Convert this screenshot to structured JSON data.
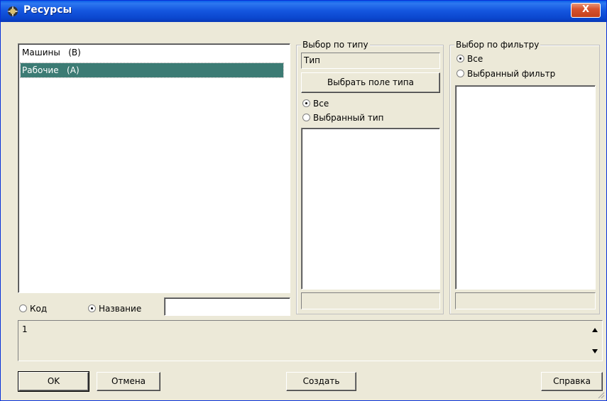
{
  "window": {
    "title": "Ресурсы",
    "close_label": "X"
  },
  "resources_list": {
    "items": [
      {
        "label": "Машины   (В)",
        "selected": false
      },
      {
        "label": "Рабочие   (А)",
        "selected": true
      }
    ]
  },
  "search": {
    "code_label": "Код",
    "name_label": "Название",
    "selected": "name",
    "value": ""
  },
  "type_filter": {
    "group_label": "Выбор по типу",
    "type_field_value": "Тип",
    "choose_button": "Выбрать поле типа",
    "radio_all": "Все",
    "radio_selected": "Выбранный тип",
    "selected": "all"
  },
  "filter_select": {
    "group_label": "Выбор по фильтру",
    "radio_all": "Все",
    "radio_selected": "Выбранный фильтр",
    "selected": "all"
  },
  "info_box": {
    "text": "1"
  },
  "buttons": {
    "ok": "OK",
    "cancel": "Отмена",
    "create": "Создать",
    "help": "Справка"
  },
  "colors": {
    "title_bar": "#0b47cf",
    "selection": "#3c7b74",
    "dialog_bg": "#ece9d8"
  }
}
